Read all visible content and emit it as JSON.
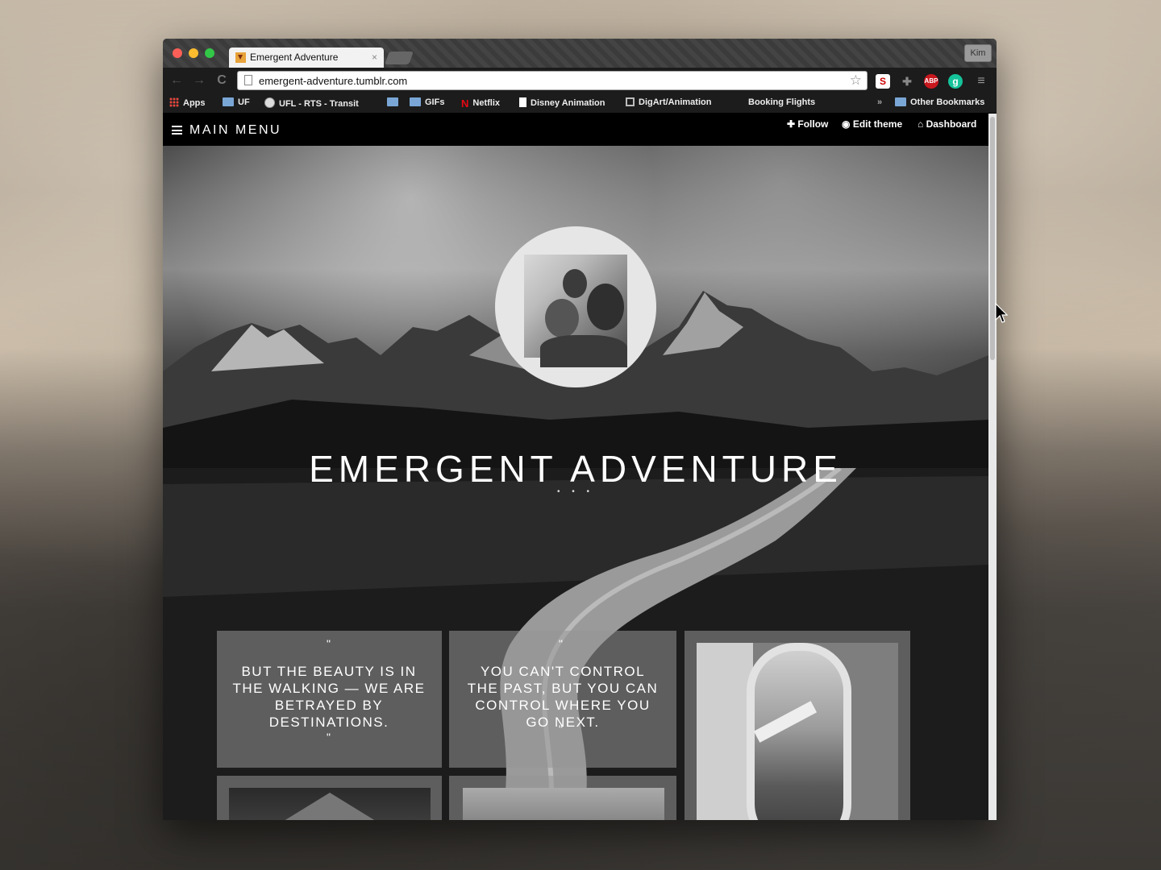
{
  "browser": {
    "tab_title": "Emergent Adventure",
    "tab_close": "×",
    "user_name": "Kim",
    "url": "emergent-adventure.tumblr.com",
    "back": "←",
    "forward": "→",
    "reload": "C",
    "star": "☆",
    "extensions": [
      {
        "name": "s-icon",
        "label": "S"
      },
      {
        "name": "puzzle-icon",
        "label": "✚"
      },
      {
        "name": "adblock-icon",
        "label": "ABP"
      },
      {
        "name": "grammarly-icon",
        "label": "g"
      },
      {
        "name": "chrome-menu-icon",
        "label": "≡"
      }
    ],
    "bookmarks": [
      {
        "label": "Apps"
      },
      {
        "label": "UF"
      },
      {
        "label": "UFL - RTS - Transit"
      },
      {
        "label": ""
      },
      {
        "label": "GIFs"
      },
      {
        "label": "Netflix"
      },
      {
        "label": "Disney Animation"
      },
      {
        "label": "DigArt/Animation"
      },
      {
        "label": "Booking Flights"
      }
    ],
    "overflow": "»",
    "other_bookmarks": "Other Bookmarks"
  },
  "site": {
    "menu_label": "MAIN MENU",
    "follow": "Follow",
    "edit_theme": "Edit theme",
    "dashboard": "Dashboard",
    "blog_title": "EMERGENT ADVENTURE",
    "title_dots": "• • •",
    "quotes": [
      {
        "open": "\"",
        "text": "BUT THE BEAUTY IS IN THE WALKING — WE ARE BETRAYED BY DESTINATIONS.",
        "close": "\""
      },
      {
        "open": "\"",
        "text": "YOU CAN'T CONTROL THE PAST, BUT YOU CAN CONTROL WHERE YOU GO NEXT.",
        "close": "\""
      }
    ]
  },
  "colors": {
    "tab_red": "#fc5f57",
    "tab_yellow": "#fdbc2e",
    "tab_green": "#33c748",
    "netflix": "#e50914",
    "abp": "#c9171e",
    "grammarly": "#15c39a"
  }
}
